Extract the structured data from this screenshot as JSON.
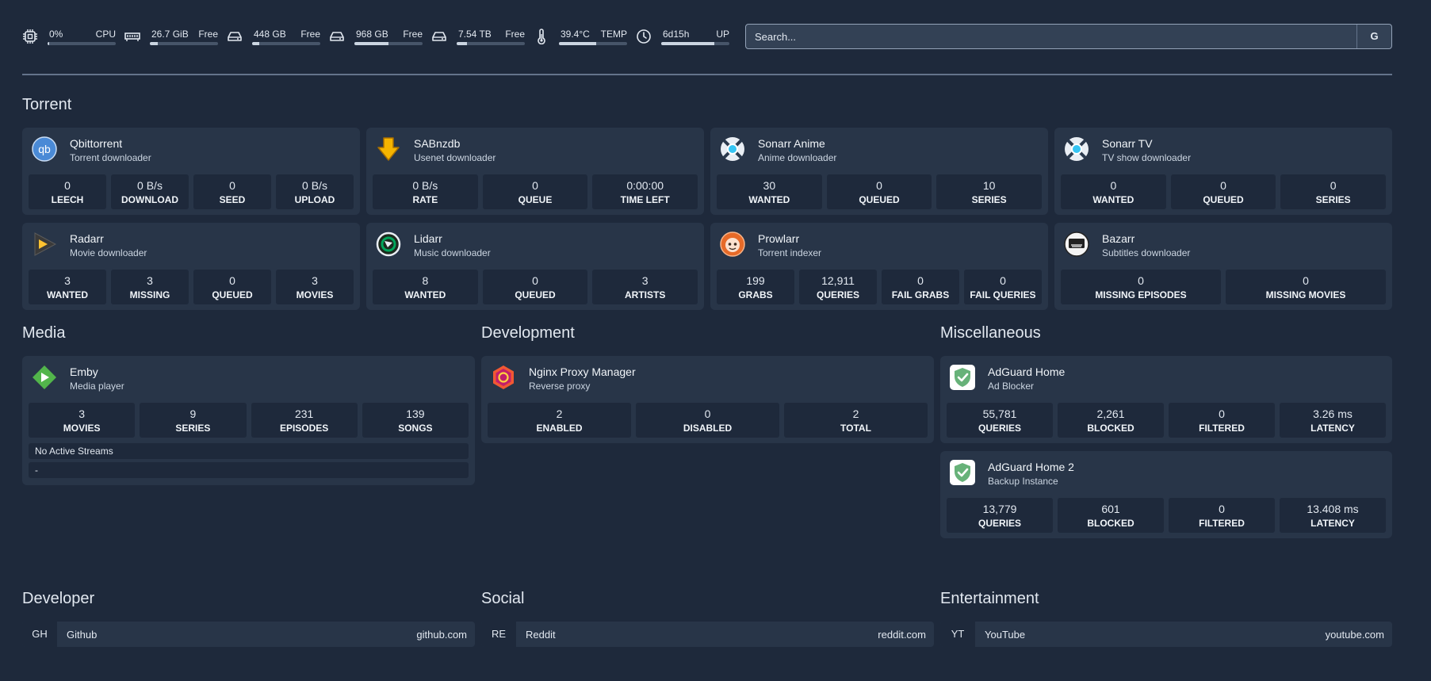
{
  "resources": [
    {
      "icon": "cpu-icon",
      "value": "0%",
      "label": "CPU",
      "fill": 0.02
    },
    {
      "icon": "memory-icon",
      "value": "26.7 GiB",
      "label": "Free",
      "fill": 0.12
    },
    {
      "icon": "disk-icon",
      "value": "448 GB",
      "label": "Free",
      "fill": 0.1
    },
    {
      "icon": "disk-icon",
      "value": "968 GB",
      "label": "Free",
      "fill": 0.5
    },
    {
      "icon": "disk-icon",
      "value": "7.54 TB",
      "label": "Free",
      "fill": 0.15
    },
    {
      "icon": "thermometer-icon",
      "value": "39.4°C",
      "label": "TEMP",
      "fill": 0.55
    },
    {
      "icon": "clock-icon",
      "value": "6d15h",
      "label": "UP",
      "fill": 0.78
    }
  ],
  "search": {
    "placeholder": "Search...",
    "button": "G"
  },
  "sections": {
    "torrent": "Torrent",
    "media": "Media",
    "development": "Development",
    "misc": "Miscellaneous",
    "developer": "Developer",
    "social": "Social",
    "entertainment": "Entertainment"
  },
  "services": {
    "qbittorrent": {
      "name": "Qbittorrent",
      "desc": "Torrent downloader",
      "stats": [
        {
          "n": "0",
          "l": "LEECH"
        },
        {
          "n": "0 B/s",
          "l": "DOWNLOAD"
        },
        {
          "n": "0",
          "l": "SEED"
        },
        {
          "n": "0 B/s",
          "l": "UPLOAD"
        }
      ]
    },
    "sabnzbd": {
      "name": "SABnzdb",
      "desc": "Usenet downloader",
      "stats": [
        {
          "n": "0 B/s",
          "l": "RATE"
        },
        {
          "n": "0",
          "l": "QUEUE"
        },
        {
          "n": "0:00:00",
          "l": "TIME LEFT"
        }
      ]
    },
    "sonarr_anime": {
      "name": "Sonarr Anime",
      "desc": "Anime downloader",
      "stats": [
        {
          "n": "30",
          "l": "WANTED"
        },
        {
          "n": "0",
          "l": "QUEUED"
        },
        {
          "n": "10",
          "l": "SERIES"
        }
      ]
    },
    "sonarr_tv": {
      "name": "Sonarr TV",
      "desc": "TV show downloader",
      "stats": [
        {
          "n": "0",
          "l": "WANTED"
        },
        {
          "n": "0",
          "l": "QUEUED"
        },
        {
          "n": "0",
          "l": "SERIES"
        }
      ]
    },
    "radarr": {
      "name": "Radarr",
      "desc": "Movie downloader",
      "stats": [
        {
          "n": "3",
          "l": "WANTED"
        },
        {
          "n": "3",
          "l": "MISSING"
        },
        {
          "n": "0",
          "l": "QUEUED"
        },
        {
          "n": "3",
          "l": "MOVIES"
        }
      ]
    },
    "lidarr": {
      "name": "Lidarr",
      "desc": "Music downloader",
      "stats": [
        {
          "n": "8",
          "l": "WANTED"
        },
        {
          "n": "0",
          "l": "QUEUED"
        },
        {
          "n": "3",
          "l": "ARTISTS"
        }
      ]
    },
    "prowlarr": {
      "name": "Prowlarr",
      "desc": "Torrent indexer",
      "stats": [
        {
          "n": "199",
          "l": "GRABS"
        },
        {
          "n": "12,911",
          "l": "QUERIES"
        },
        {
          "n": "0",
          "l": "FAIL GRABS"
        },
        {
          "n": "0",
          "l": "FAIL QUERIES"
        }
      ]
    },
    "bazarr": {
      "name": "Bazarr",
      "desc": "Subtitles downloader",
      "stats": [
        {
          "n": "0",
          "l": "MISSING EPISODES"
        },
        {
          "n": "0",
          "l": "MISSING MOVIES"
        }
      ]
    },
    "emby": {
      "name": "Emby",
      "desc": "Media player",
      "stats": [
        {
          "n": "3",
          "l": "MOVIES"
        },
        {
          "n": "9",
          "l": "SERIES"
        },
        {
          "n": "231",
          "l": "EPISODES"
        },
        {
          "n": "139",
          "l": "SONGS"
        }
      ],
      "streams": "No Active Streams",
      "stream_detail": "-"
    },
    "npm": {
      "name": "Nginx Proxy Manager",
      "desc": "Reverse proxy",
      "stats": [
        {
          "n": "2",
          "l": "ENABLED"
        },
        {
          "n": "0",
          "l": "DISABLED"
        },
        {
          "n": "2",
          "l": "TOTAL"
        }
      ]
    },
    "adguard": {
      "name": "AdGuard Home",
      "desc": "Ad Blocker",
      "stats": [
        {
          "n": "55,781",
          "l": "QUERIES"
        },
        {
          "n": "2,261",
          "l": "BLOCKED"
        },
        {
          "n": "0",
          "l": "FILTERED"
        },
        {
          "n": "3.26 ms",
          "l": "LATENCY"
        }
      ]
    },
    "adguard2": {
      "name": "AdGuard Home 2",
      "desc": "Backup Instance",
      "stats": [
        {
          "n": "13,779",
          "l": "QUERIES"
        },
        {
          "n": "601",
          "l": "BLOCKED"
        },
        {
          "n": "0",
          "l": "FILTERED"
        },
        {
          "n": "13.408 ms",
          "l": "LATENCY"
        }
      ]
    }
  },
  "bookmarks": {
    "github": {
      "abbr": "GH",
      "name": "Github",
      "url": "github.com"
    },
    "reddit": {
      "abbr": "RE",
      "name": "Reddit",
      "url": "reddit.com"
    },
    "youtube": {
      "abbr": "YT",
      "name": "YouTube",
      "url": "youtube.com"
    }
  },
  "colors": {
    "background": "#1e293b",
    "card": "#283548",
    "stat_box": "#1e293b",
    "accent_light": "#e2e8f0"
  }
}
